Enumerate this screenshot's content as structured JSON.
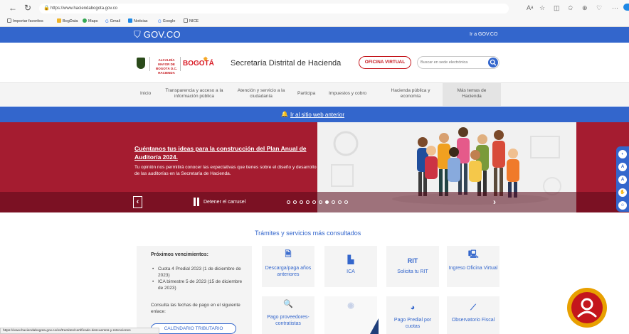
{
  "browser": {
    "url": "https://www.haciendabogota.gov.co",
    "bookmarks": [
      "Importar favoritos",
      "BogData",
      "Maps",
      "Gmail",
      "Noticias",
      "Google",
      "NICE"
    ],
    "status_url": "https://www.haciendabogota.gov.co/es/tramites/certificado-descuentos-y-retenciones"
  },
  "gov_bar": {
    "logo": "GOV.CO",
    "link": "Ir a GOV.CO"
  },
  "header": {
    "alcaldia": "ALCALDÍA MAYOR DE BOGOTÁ D.C. HACIENDA",
    "bogota": "BOGOTÁ",
    "title": "Secretaría Distrital de Hacienda",
    "oficina_virtual": "OFICINA VIRTUAL",
    "search_placeholder": "Buscar en sede electrónica"
  },
  "nav": {
    "items": [
      "Inicio",
      "Transparencia y acceso a la información pública",
      "Atención y servicio a la ciudadanía",
      "Participa",
      "Impuestos y cobro",
      "Hacienda pública y economía",
      "Más temas de Hacienda"
    ]
  },
  "notice": {
    "text": "Ir al sitio web anterior"
  },
  "banner": {
    "title": "Cuéntanos tus ideas para la construcción del Plan Anual de Auditoría 2024.",
    "description": "Tu opinión nos permitirá conocer las expectativas que tienes sobre el diseño y desarrollo de las auditorías en la Secretaría de Hacienda.",
    "stop_label": "Detener el carrusel",
    "dot_count": 10,
    "active_dot": 6
  },
  "services": {
    "title": "Trámites y servicios más consultados",
    "vencimientos": {
      "title": "Próximos vencimientos:",
      "items": [
        "Cuota 4 Predial 2023 (1 de diciembre de 2023)",
        "ICA bimestre 5 de 2023 (15 de diciembre de 2023)"
      ],
      "note": "Consulta las fechas de pago en el siguiente enlace:",
      "button": "CALENDARIO TRIBUTARIO"
    },
    "cards": [
      {
        "label": "Descarga/paga años anteriores",
        "icon": "document-icon"
      },
      {
        "label": "ICA",
        "icon": "factory-icon"
      },
      {
        "label": "Solicita tu RIT",
        "icon_text": "RIT",
        "icon": "rit-icon"
      },
      {
        "label": "Ingreso Oficina Virtual",
        "icon": "computer-icon"
      },
      {
        "label": "Pago proveedores-contratistas",
        "icon": "search-coin-icon"
      },
      {
        "label": "",
        "icon": "placeholder-icon"
      },
      {
        "label": "Pago Predial por cuotas",
        "icon": "pie-chart-icon"
      },
      {
        "label": "Observatorio Fiscal",
        "icon": "telescope-icon"
      }
    ]
  },
  "colors": {
    "gov_blue": "#3366cc",
    "banner_red": "#a51c30",
    "accent_red": "#c4161c"
  }
}
